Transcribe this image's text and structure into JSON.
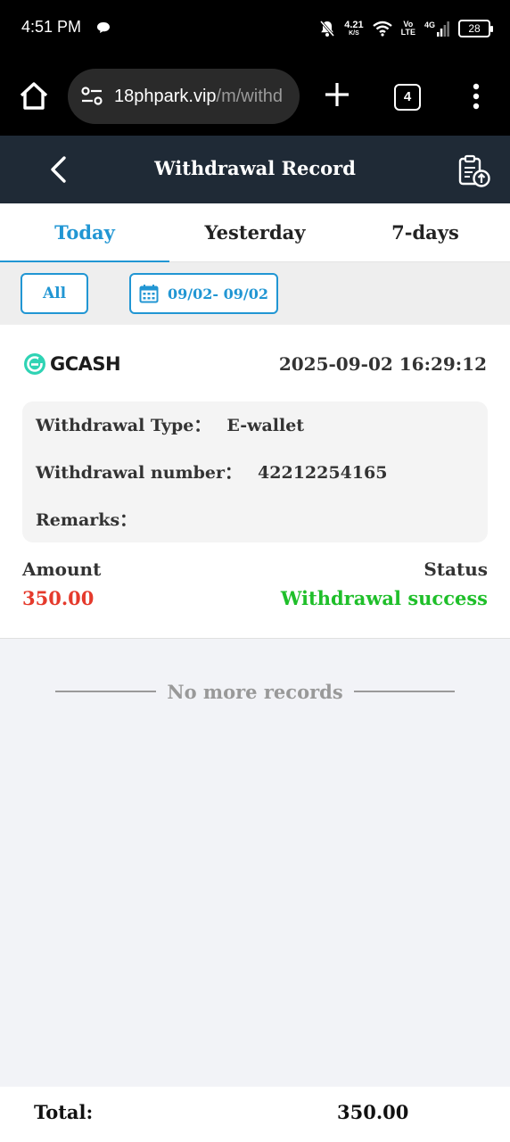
{
  "status_bar": {
    "time": "4:51 PM",
    "net_speed": "4.21",
    "net_speed_unit": "K/S",
    "volte_top": "Vo",
    "volte_bottom": "LTE",
    "network": "4G",
    "battery": "28",
    "icons": [
      "chat-bubble-icon",
      "bell-muted-icon",
      "wifi-icon",
      "signal-icon",
      "battery-icon"
    ]
  },
  "browser": {
    "url_host": "18phpark.vip",
    "url_path": "/m/withd",
    "tab_count": "4",
    "icons": [
      "home-icon",
      "site-settings-icon",
      "plus-icon",
      "menu-dots-icon"
    ]
  },
  "header": {
    "title": "Withdrawal Record",
    "icons": [
      "back-arrow-icon",
      "clipboard-upload-icon"
    ],
    "bg_color": "#1f2a36"
  },
  "tabs": [
    {
      "label": "Today",
      "active": true
    },
    {
      "label": "Yesterday",
      "active": false
    },
    {
      "label": "7-days",
      "active": false
    }
  ],
  "filters": {
    "all_label": "All",
    "date_range": "09/02- 09/02",
    "accent_color": "#2196d3"
  },
  "record": {
    "method": "GCASH",
    "datetime": "2025-09-02 16:29:12",
    "type_label": "Withdrawal Type：",
    "type_value": "E-wallet",
    "number_label": "Withdrawal number：",
    "number_value": "42212254165",
    "remarks_label": "Remarks：",
    "remarks_value": "",
    "amount_label": "Amount",
    "amount_value": "350.00",
    "status_label": "Status",
    "status_value": "Withdrawal success",
    "amount_color": "#e53a2c",
    "status_color": "#1fbf2a"
  },
  "no_more": "No more records",
  "footer": {
    "total_label": "Total:",
    "total_value": "350.00"
  }
}
